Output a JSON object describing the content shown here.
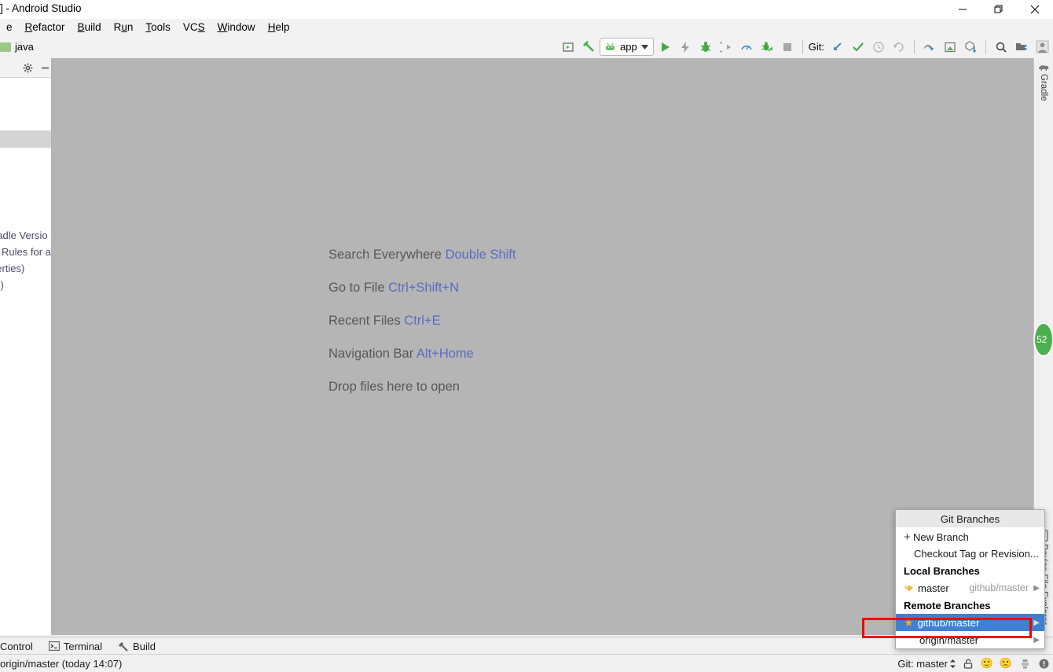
{
  "window": {
    "title": "] - Android Studio",
    "controls": {
      "minimize": "minimize-icon",
      "restore": "restore-icon",
      "close": "close-icon"
    }
  },
  "menubar": {
    "items": [
      {
        "label": "e",
        "mnemonic": ""
      },
      {
        "label": "Refactor",
        "mnemonic": "R"
      },
      {
        "label": "Build",
        "mnemonic": "B"
      },
      {
        "label": "Run",
        "mnemonic": "u"
      },
      {
        "label": "Tools",
        "mnemonic": "T"
      },
      {
        "label": "VCS",
        "mnemonic": "S"
      },
      {
        "label": "Window",
        "mnemonic": "W"
      },
      {
        "label": "Help",
        "mnemonic": "H"
      }
    ]
  },
  "toolbar": {
    "breadcrumb": "java",
    "run_config": "app",
    "git_label": "Git:",
    "icons": [
      "avd-manager-icon",
      "build-hammer-icon",
      "run-icon",
      "apply-changes-icon",
      "debug-icon",
      "attach-debugger-icon",
      "profiler-icon",
      "sync-gradle-icon",
      "stop-icon",
      "update-project-icon",
      "commit-icon",
      "history-icon",
      "rollback-icon",
      "sdk-manager-icon",
      "layout-inspector-icon",
      "apk-analyzer-icon",
      "search-icon",
      "project-structure-icon",
      "user-account-icon"
    ]
  },
  "editor": {
    "shortcuts": [
      {
        "action": "Search Everywhere",
        "key": "Double Shift"
      },
      {
        "action": "Go to File",
        "key": "Ctrl+Shift+N"
      },
      {
        "action": "Recent Files",
        "key": "Ctrl+E"
      },
      {
        "action": "Navigation Bar",
        "key": "Alt+Home"
      },
      {
        "action": "Drop files here to open",
        "key": ""
      }
    ]
  },
  "project_panel": {
    "header_icons": [
      "gear-icon",
      "minimize-icon"
    ],
    "clipped_rows": [
      "radle Versio",
      "Rules for a",
      "perties)",
      "s)",
      ")"
    ]
  },
  "right_strip": {
    "gradle_label": "Gradle",
    "device_file_explorer_label": "Device File Explorer",
    "badge": "52"
  },
  "git_popup": {
    "title": "Git Branches",
    "new_branch": "New Branch",
    "checkout": "Checkout Tag or Revision...",
    "local_header": "Local Branches",
    "local_branches": [
      {
        "name": "master",
        "tracking": "github/master",
        "icon": "tag-icon"
      }
    ],
    "remote_header": "Remote Branches",
    "remote_branches": [
      {
        "name": "github/master",
        "selected": true,
        "icon": "star-icon"
      },
      {
        "name": "origin/master",
        "selected": false,
        "icon": ""
      }
    ],
    "highlight_color": "#ee0000",
    "selection_color": "#3f7fd4"
  },
  "bottom_tabs": [
    {
      "label": "Control",
      "icon": ""
    },
    {
      "label": "Terminal",
      "icon": "terminal-icon"
    },
    {
      "label": "Build",
      "icon": "hammer-icon"
    }
  ],
  "status_bar": {
    "left_text": "origin/master (today 14:07)",
    "git_branch": "Git: master",
    "icons": [
      "lock-icon",
      "happy-face-icon",
      "sad-face-icon",
      "memory-icon",
      "notification-icon"
    ]
  }
}
